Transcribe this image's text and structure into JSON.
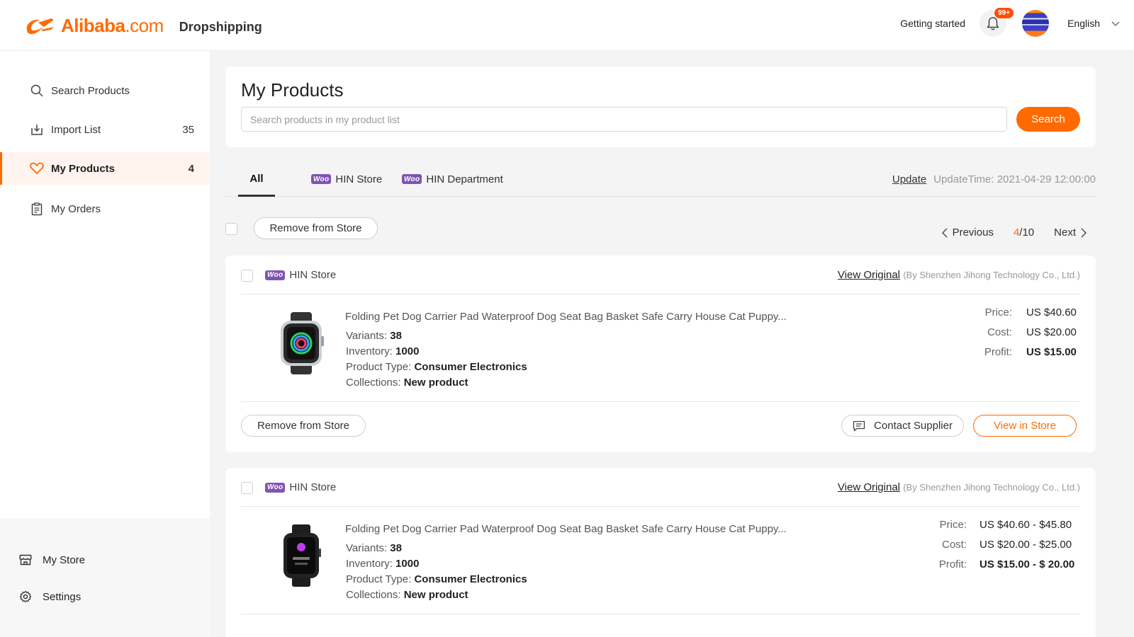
{
  "header": {
    "brand": "Alibaba",
    "brand_suffix": ".com",
    "product_name": "Dropshipping",
    "getting_started": "Getting started",
    "notification_badge": "99+",
    "language": "English"
  },
  "sidebar": {
    "items": [
      {
        "label": "Search Products",
        "count": "",
        "icon": "search-icon"
      },
      {
        "label": "Import List",
        "count": "35",
        "icon": "import-icon"
      },
      {
        "label": "My Products",
        "count": "4",
        "icon": "heart-icon",
        "active": true
      },
      {
        "label": "My Orders",
        "count": "",
        "icon": "orders-icon"
      }
    ],
    "bottom": [
      {
        "label": "My Store",
        "icon": "store-icon"
      },
      {
        "label": "Settings",
        "icon": "gear-icon"
      }
    ]
  },
  "main": {
    "title": "My Products",
    "search": {
      "placeholder": "Search products in my product list",
      "value": "",
      "button": "Search"
    },
    "tabs": [
      {
        "label": "All",
        "active": true
      },
      {
        "label": "HIN Store",
        "badge": "woo"
      },
      {
        "label": "HIN Department",
        "badge": "woo"
      }
    ],
    "update_label": "Update",
    "update_time": "UpdateTime: 2021-04-29  12:00:00",
    "bulk_remove": "Remove from Store",
    "pager": {
      "previous": "Previous",
      "current": "4",
      "total": "/10",
      "next": "Next"
    },
    "woo_badge": "Woo"
  },
  "products": [
    {
      "store": "HIN Store",
      "view_original": "View Original",
      "supplier": "(By Shenzhen Jihong Technology Co., Ltd.)",
      "title": "Folding Pet Dog Carrier Pad Waterproof Dog Seat Bag Basket Safe Carry House Cat Puppy...",
      "variants_label": "Variants: ",
      "variants": "38",
      "inventory_label": "Inventory: ",
      "inventory": "1000",
      "type_label": "Product Type: ",
      "type": "Consumer Electronics",
      "collections_label": "Collections: ",
      "collections": "New product",
      "price_label": "Price:",
      "price": "US $40.60",
      "cost_label": "Cost:",
      "cost": "US $20.00",
      "profit_label": "Profit:",
      "profit": "US $15.00",
      "remove": "Remove from Store",
      "contact": "Contact Supplier",
      "view_store": "View in Store",
      "image_icon": "smartwatch-icon"
    },
    {
      "store": "HIN Store",
      "view_original": "View Original",
      "supplier": "(By Shenzhen Jihong Technology Co., Ltd.)",
      "title": "Folding Pet Dog Carrier Pad Waterproof Dog Seat Bag Basket Safe Carry House Cat Puppy...",
      "variants_label": "Variants: ",
      "variants": "38",
      "inventory_label": "Inventory: ",
      "inventory": "1000",
      "type_label": "Product Type: ",
      "type": "Consumer Electronics",
      "collections_label": "Collections: ",
      "collections": "New product",
      "price_label": "Price:",
      "price": "US $40.60 - $45.80",
      "cost_label": "Cost:",
      "cost": "US $20.00 - $25.00",
      "profit_label": "Profit:",
      "profit": "US $15.00 - $ 20.00",
      "image_icon": "smartwatch-icon"
    }
  ],
  "colors": {
    "accent": "#ff6a00",
    "woo": "#7f54b3"
  }
}
